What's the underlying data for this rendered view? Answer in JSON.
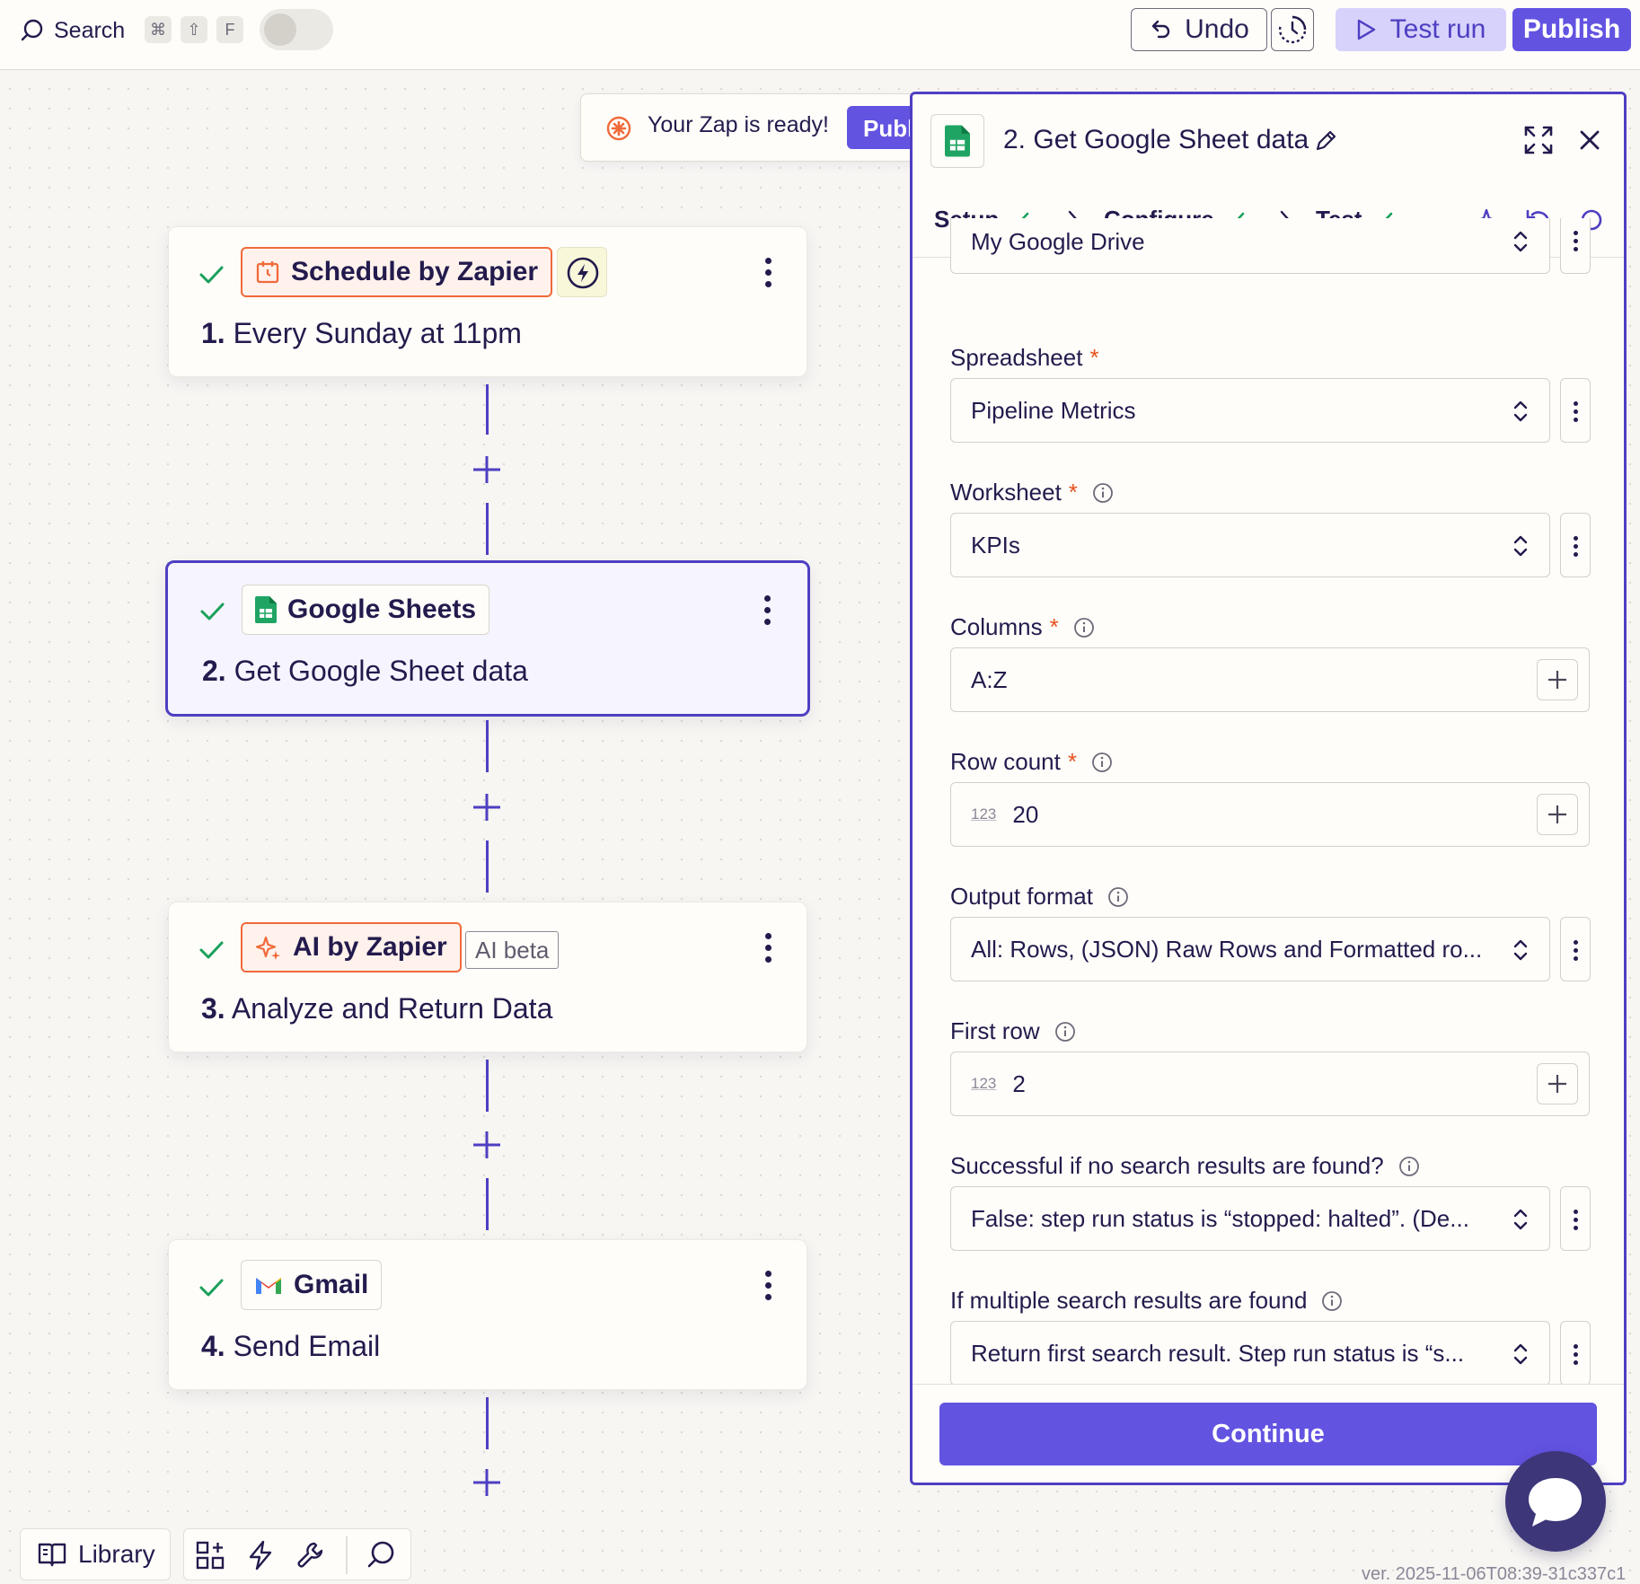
{
  "topbar": {
    "search_label": "Search",
    "shortcut_keys": [
      "⌘",
      "⇧",
      "F"
    ],
    "undo_label": "Undo",
    "test_run_label": "Test run",
    "publish_label": "Publish"
  },
  "banner": {
    "message": "Your Zap is ready!",
    "publish_label": "Publ"
  },
  "steps": [
    {
      "app": "Schedule by Zapier",
      "number": "1.",
      "title": "Every Sunday at 11pm"
    },
    {
      "app": "Google Sheets",
      "number": "2.",
      "title": "Get Google Sheet data"
    },
    {
      "app": "AI by Zapier",
      "badge": "AI beta",
      "number": "3.",
      "title": "Analyze and Return Data"
    },
    {
      "app": "Gmail",
      "number": "4.",
      "title": "Send Email"
    }
  ],
  "panel": {
    "title": "2. Get Google Sheet data",
    "tabs": [
      {
        "label": "Setup"
      },
      {
        "label": "Configure"
      },
      {
        "label": "Test"
      }
    ],
    "drive_value": "My Google Drive",
    "fields": {
      "spreadsheet": {
        "label": "Spreadsheet",
        "value": "Pipeline Metrics"
      },
      "worksheet": {
        "label": "Worksheet",
        "value": "KPIs"
      },
      "columns": {
        "label": "Columns",
        "value": "A:Z"
      },
      "row_count": {
        "label": "Row count",
        "value": "20",
        "type_tag": "123"
      },
      "output_format": {
        "label": "Output format",
        "value": "All: Rows, (JSON) Raw Rows and Formatted ro..."
      },
      "first_row": {
        "label": "First row",
        "value": "2",
        "type_tag": "123"
      },
      "no_results": {
        "label": "Successful if no search results are found?",
        "value": "False: step run status is “stopped: halted”. (De..."
      },
      "multiple_results": {
        "label": "If multiple search results are found",
        "value": "Return first search result. Step run status is “s..."
      }
    },
    "required_mark": "*",
    "continue_label": "Continue"
  },
  "bottom": {
    "library_label": "Library",
    "version": "ver. 2025-11-06T08:39-31c337c1"
  },
  "colors": {
    "accent": "#4e3fc2",
    "publish_bg": "#6253e1",
    "test_run_bg": "#d6d2fb",
    "check_green": "#19a05b",
    "zapier_orange": "#f06a3a",
    "required_red": "#e8521f"
  }
}
